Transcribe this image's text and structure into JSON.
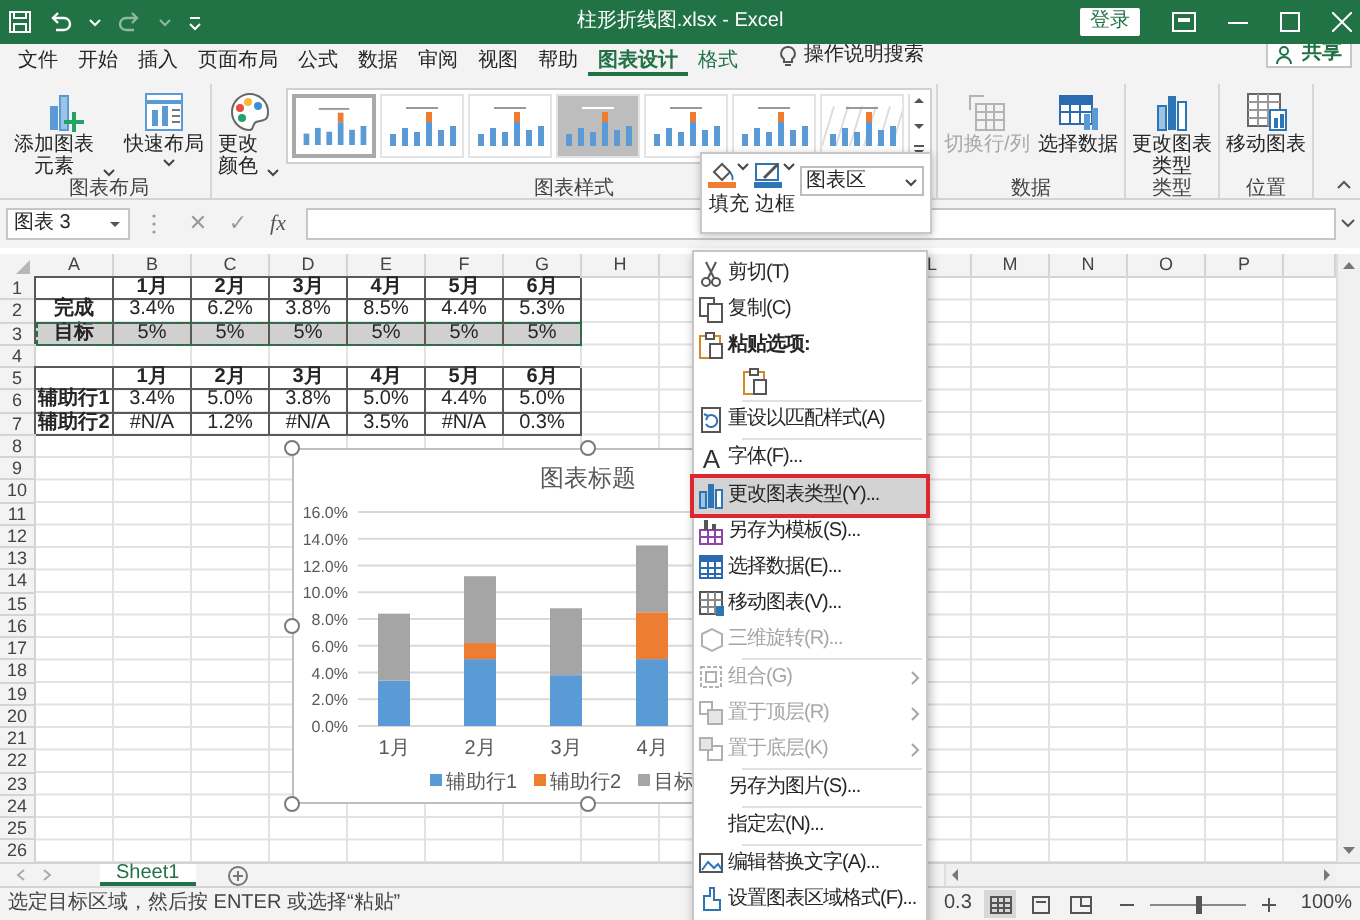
{
  "window": {
    "title": "柱形折线图.xlsx  -  Excel",
    "sign_in": "登录"
  },
  "ribbon_tabs": [
    {
      "label": "文件",
      "selected": false,
      "contextual": false
    },
    {
      "label": "开始",
      "selected": false,
      "contextual": false
    },
    {
      "label": "插入",
      "selected": false,
      "contextual": false
    },
    {
      "label": "页面布局",
      "selected": false,
      "contextual": false
    },
    {
      "label": "公式",
      "selected": false,
      "contextual": false
    },
    {
      "label": "数据",
      "selected": false,
      "contextual": false
    },
    {
      "label": "审阅",
      "selected": false,
      "contextual": false
    },
    {
      "label": "视图",
      "selected": false,
      "contextual": false
    },
    {
      "label": "帮助",
      "selected": false,
      "contextual": false
    },
    {
      "label": "图表设计",
      "selected": true,
      "contextual": true
    },
    {
      "label": "格式",
      "selected": false,
      "contextual": true
    }
  ],
  "tell_me": "操作说明搜索",
  "share": "共享",
  "ribbon_groups": [
    {
      "label": "图表布局",
      "buttons": [
        {
          "label": "添加图表元素",
          "dropdown": true,
          "disabled": false
        },
        {
          "label": "快速布局",
          "dropdown": true,
          "disabled": false
        }
      ]
    },
    {
      "label": "图表样式",
      "buttons": [
        {
          "label": "更改颜色",
          "dropdown": true,
          "disabled": false
        }
      ],
      "styles": [
        {
          "kind": "light",
          "selected": true
        },
        {
          "kind": "light",
          "selected": false
        },
        {
          "kind": "light",
          "selected": false
        },
        {
          "kind": "dark",
          "selected": false
        },
        {
          "kind": "light",
          "selected": false
        },
        {
          "kind": "light",
          "selected": false
        },
        {
          "kind": "pattern",
          "selected": false
        }
      ]
    },
    {
      "label": "数据",
      "buttons": [
        {
          "label": "切换行/列",
          "dropdown": false,
          "disabled": true
        },
        {
          "label": "选择数据",
          "dropdown": false,
          "disabled": false
        }
      ]
    },
    {
      "label": "类型",
      "buttons": [
        {
          "label": "更改图表类型",
          "dropdown": false,
          "disabled": false
        }
      ]
    },
    {
      "label": "位置",
      "buttons": [
        {
          "label": "移动图表",
          "dropdown": false,
          "disabled": false
        }
      ]
    }
  ],
  "mini_toolbar": {
    "fill": "填充",
    "outline": "边框",
    "element": "图表区"
  },
  "formula_bar": {
    "name_box": "图表 3",
    "cancel": "✕",
    "enter": "✓",
    "insert_function": "fx"
  },
  "sheet": {
    "columns": [
      "A",
      "B",
      "C",
      "D",
      "E",
      "F",
      "G",
      "H"
    ],
    "columns_right": [
      "L",
      "M",
      "N",
      "O",
      "P"
    ],
    "row_headers": [
      "1",
      "2",
      "3",
      "4",
      "5",
      "6",
      "7",
      "8",
      "9",
      "10",
      "11",
      "12",
      "13",
      "14",
      "15",
      "16",
      "17",
      "18",
      "19",
      "20",
      "21",
      "22",
      "23",
      "24",
      "25",
      "26"
    ],
    "rows": [
      {
        "bordered": true,
        "header": true,
        "copied": false,
        "cells": [
          null,
          "1月",
          "2月",
          "3月",
          "4月",
          "5月",
          "6月"
        ]
      },
      {
        "bordered": true,
        "header": false,
        "copied": false,
        "cells": [
          "完成",
          "3.4%",
          "6.2%",
          "3.8%",
          "8.5%",
          "4.4%",
          "5.3%"
        ]
      },
      {
        "bordered": true,
        "header": false,
        "copied": true,
        "cells": [
          "目标",
          "5%",
          "5%",
          "5%",
          "5%",
          "5%",
          "5%"
        ]
      },
      {
        "bordered": false,
        "copied": false
      },
      {
        "bordered": true,
        "header": true,
        "copied": false,
        "cells": [
          null,
          "1月",
          "2月",
          "3月",
          "4月",
          "5月",
          "6月"
        ]
      },
      {
        "bordered": true,
        "header": false,
        "copied": false,
        "cells": [
          "辅助行1",
          "3.4%",
          "5.0%",
          "3.8%",
          "5.0%",
          "4.4%",
          "5.0%"
        ]
      },
      {
        "bordered": true,
        "header": false,
        "copied": false,
        "cells": [
          "辅助行2",
          "#N/A",
          "1.2%",
          "#N/A",
          "3.5%",
          "#N/A",
          "0.3%"
        ]
      }
    ]
  },
  "chart": {
    "chart_data": {
      "type": "bar",
      "title": "图表标题",
      "stacked": true,
      "grid": true,
      "legend": "bottom",
      "categories": [
        "1月",
        "2月",
        "3月",
        "4月"
      ],
      "series": [
        {
          "name": "辅助行1",
          "color": "#5b9bd5",
          "values": [
            3.4,
            5.0,
            3.8,
            5.0
          ]
        },
        {
          "name": "辅助行2",
          "color": "#ed7d31",
          "values": [
            null,
            1.2,
            null,
            3.5
          ]
        },
        {
          "name": "目标",
          "color": "#a5a5a5",
          "values": [
            5,
            5,
            5,
            5
          ]
        }
      ],
      "ylim": [
        0,
        16
      ],
      "yticks": [
        {
          "value": 0,
          "label": "0.0%"
        },
        {
          "value": 2,
          "label": "2.0%"
        },
        {
          "value": 4,
          "label": "4.0%"
        },
        {
          "value": 6,
          "label": "6.0%"
        },
        {
          "value": 8,
          "label": "8.0%"
        },
        {
          "value": 10,
          "label": "10.0%"
        },
        {
          "value": 12,
          "label": "12.0%"
        },
        {
          "value": 14,
          "label": "14.0%"
        },
        {
          "value": 16,
          "label": "16.0%"
        }
      ]
    }
  },
  "context_menu": [
    {
      "kind": "item",
      "label": "剪切(T)",
      "disabled": false,
      "submenu": false,
      "selected": false
    },
    {
      "kind": "item",
      "label": "复制(C)",
      "disabled": false,
      "submenu": false,
      "selected": false
    },
    {
      "kind": "heading",
      "label": "粘贴选项:"
    },
    {
      "kind": "paste_button"
    },
    {
      "kind": "separator"
    },
    {
      "kind": "item",
      "label": "重设以匹配样式(A)",
      "disabled": false,
      "submenu": false,
      "selected": false
    },
    {
      "kind": "separator"
    },
    {
      "kind": "item",
      "label": "字体(F)...",
      "glyph": "A",
      "disabled": false,
      "submenu": false,
      "selected": false
    },
    {
      "kind": "separator"
    },
    {
      "kind": "item",
      "label": "更改图表类型(Y)...",
      "disabled": false,
      "submenu": false,
      "selected": true
    },
    {
      "kind": "item",
      "label": "另存为模板(S)...",
      "disabled": false,
      "submenu": false,
      "selected": false
    },
    {
      "kind": "item",
      "label": "选择数据(E)...",
      "disabled": false,
      "submenu": false,
      "selected": false
    },
    {
      "kind": "item",
      "label": "移动图表(V)...",
      "disabled": false,
      "submenu": false,
      "selected": false
    },
    {
      "kind": "item",
      "label": "三维旋转(R)...",
      "disabled": true,
      "submenu": false,
      "selected": false
    },
    {
      "kind": "separator"
    },
    {
      "kind": "item",
      "label": "组合(G)",
      "disabled": true,
      "submenu": true,
      "selected": false
    },
    {
      "kind": "item",
      "label": "置于顶层(R)",
      "disabled": true,
      "submenu": true,
      "selected": false
    },
    {
      "kind": "item",
      "label": "置于底层(K)",
      "disabled": true,
      "submenu": true,
      "selected": false
    },
    {
      "kind": "separator"
    },
    {
      "kind": "item",
      "label": "另存为图片(S)...",
      "disabled": false,
      "submenu": false,
      "selected": false
    },
    {
      "kind": "separator"
    },
    {
      "kind": "item",
      "label": "指定宏(N)...",
      "disabled": false,
      "submenu": false,
      "selected": false
    },
    {
      "kind": "separator"
    },
    {
      "kind": "item",
      "label": "编辑替换文字(A)...",
      "disabled": false,
      "submenu": false,
      "selected": false
    },
    {
      "kind": "item",
      "label": "设置图表区域格式(F)...",
      "disabled": false,
      "submenu": false,
      "selected": false
    }
  ],
  "sheet_tabs": [
    {
      "label": "Sheet1",
      "selected": true
    }
  ],
  "status_bar": {
    "message": "选定目标区域，然后按 ENTER 或选择“粘贴”",
    "summary": "0.3",
    "views": [
      {
        "selected": true
      },
      {
        "selected": false
      },
      {
        "selected": false
      }
    ],
    "zoom": {
      "level": 0.5
    },
    "zoom_percent": "100%"
  }
}
